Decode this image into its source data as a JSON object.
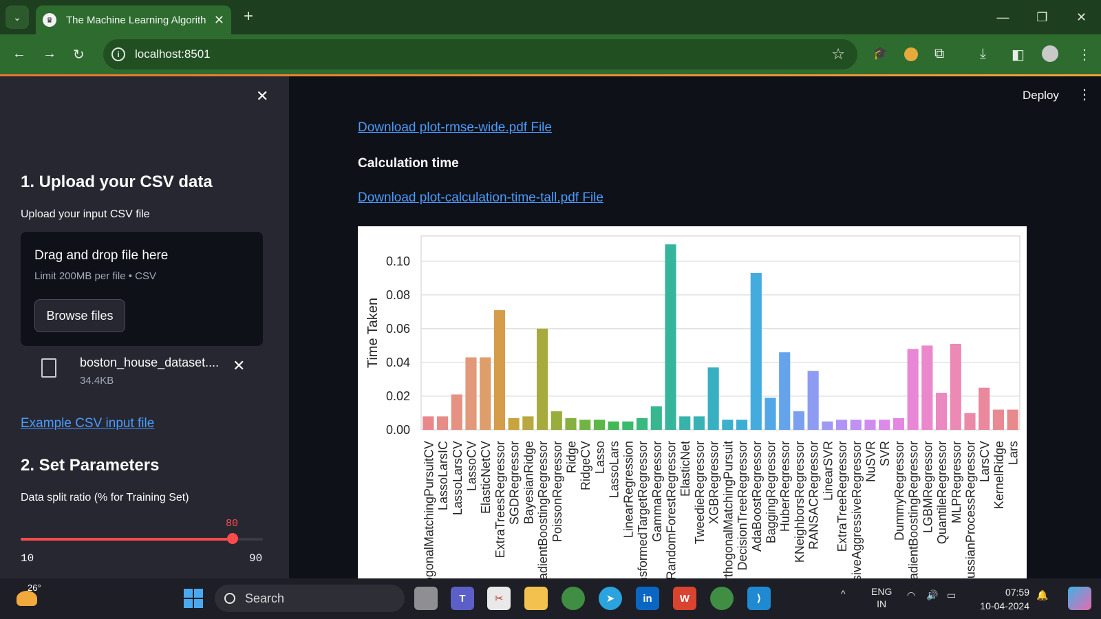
{
  "browser": {
    "tab_title": "The Machine Learning Algorith",
    "url": "localhost:8501"
  },
  "sidebar": {
    "section1_title": "1. Upload your CSV data",
    "upload_label": "Upload your input CSV file",
    "dropzone_title": "Drag and drop file here",
    "dropzone_limit": "Limit 200MB per file • CSV",
    "browse_button": "Browse files",
    "file_name": "boston_house_dataset....",
    "file_size": "34.4KB",
    "example_link": "Example CSV input file",
    "section2_title": "2. Set Parameters",
    "split_label": "Data split ratio (% for Training Set)",
    "split_value": "80",
    "split_value_fraction": 0.875,
    "split_min": "10",
    "split_max": "90"
  },
  "main": {
    "deploy_label": "Deploy",
    "download_rmse_link": "Download plot-rmse-wide.pdf File",
    "calc_time_heading": "Calculation time",
    "download_time_link": "Download plot-calculation-time-tall.pdf File"
  },
  "taskbar": {
    "temperature": "26°",
    "search_placeholder": "Search",
    "lang_top": "ENG",
    "lang_bottom": "IN",
    "time": "07:59",
    "date": "10-04-2024"
  },
  "chart_data": {
    "type": "bar",
    "title": "",
    "xlabel": "",
    "ylabel": "Time Taken",
    "ylim": [
      0,
      0.115
    ],
    "yticks": [
      "0.00",
      "0.02",
      "0.04",
      "0.06",
      "0.08",
      "0.10"
    ],
    "grid": true,
    "categories": [
      "OrthogonalMatchingPursuitCV",
      "LassoLarsIC",
      "LassoLarsCV",
      "LassoCV",
      "ElasticNetCV",
      "ExtraTreesRegressor",
      "SGDRegressor",
      "BayesianRidge",
      "GradientBoostingRegressor",
      "PoissonRegressor",
      "Ridge",
      "RidgeCV",
      "Lasso",
      "LassoLars",
      "LinearRegression",
      "TransformedTargetRegressor",
      "GammaRegressor",
      "RandomForestRegressor",
      "ElasticNet",
      "TweedieRegressor",
      "XGBRegressor",
      "OrthogonalMatchingPursuit",
      "DecisionTreeRegressor",
      "AdaBoostRegressor",
      "BaggingRegressor",
      "HuberRegressor",
      "KNeighborsRegressor",
      "RANSACRegressor",
      "LinearSVR",
      "ExtraTreeRegressor",
      "PassiveAggressiveRegressor",
      "NuSVR",
      "SVR",
      "DummyRegressor",
      "HistGradientBoostingRegressor",
      "LGBMRegressor",
      "QuantileRegressor",
      "MLPRegressor",
      "GaussianProcessRegressor",
      "LarsCV",
      "KernelRidge",
      "Lars"
    ],
    "values": [
      0.008,
      0.008,
      0.021,
      0.043,
      0.043,
      0.071,
      0.007,
      0.008,
      0.06,
      0.011,
      0.007,
      0.006,
      0.006,
      0.005,
      0.005,
      0.007,
      0.014,
      0.11,
      0.008,
      0.008,
      0.037,
      0.006,
      0.006,
      0.093,
      0.019,
      0.046,
      0.011,
      0.035,
      0.005,
      0.006,
      0.006,
      0.006,
      0.006,
      0.007,
      0.048,
      0.05,
      0.022,
      0.051,
      0.01,
      0.025,
      0.012,
      0.012
    ],
    "colors": [
      "#e8878c",
      "#e88c88",
      "#e69283",
      "#e2987a",
      "#de9d6a",
      "#d59c4a",
      "#c9a43e",
      "#b9a83f",
      "#a7ab3d",
      "#97ae3d",
      "#86b13f",
      "#72b443",
      "#5bb749",
      "#42b955",
      "#3aba6b",
      "#39b87f",
      "#38b68f",
      "#36b59d",
      "#37b3a9",
      "#38b2b5",
      "#39b0c1",
      "#3bafcb",
      "#3eadd5",
      "#44abdf",
      "#52a8e6",
      "#65a4ec",
      "#7aa0ef",
      "#8d9cf2",
      "#9f98f4",
      "#b094f4",
      "#c090f2",
      "#cf8cef",
      "#db89ea",
      "#e487e2",
      "#e987d7",
      "#eb87cc",
      "#ec88c1",
      "#ec89b5",
      "#eb89a9",
      "#ea899e",
      "#e98993",
      "#e8898c"
    ]
  }
}
